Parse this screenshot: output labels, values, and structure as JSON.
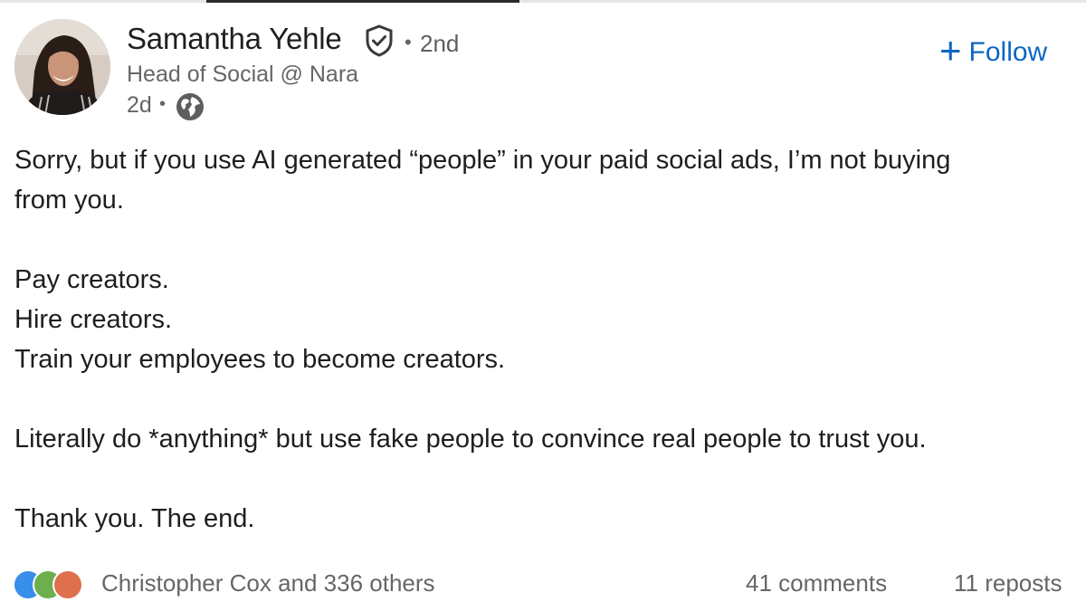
{
  "post": {
    "author": {
      "name": "Samantha Yehle",
      "connection_degree": "2nd",
      "headline": "Head of Social @ Nara",
      "time_posted": "2d",
      "verified_icon": "verified-shield-icon",
      "visibility_icon": "globe-icon"
    },
    "follow_button": {
      "plus": "+",
      "label": "Follow",
      "color": "#0a66c2"
    },
    "separator": "•",
    "body": {
      "line1": "Sorry, but if you use AI generated “people” in your paid social ads, I’m not buying",
      "line2": "from you.",
      "line3": "Pay creators.",
      "line4": "Hire creators.",
      "line5": "Train your employees to become creators.",
      "line6": "Literally do *anything* but use fake people to convince real people to trust you.",
      "line7": "Thank you. The end."
    },
    "social": {
      "reactions_text": "Christopher Cox and 336 others",
      "comments": "41 comments",
      "reposts": "11 reposts",
      "reaction_icons": [
        "like-icon",
        "support-icon",
        "love-icon"
      ]
    }
  }
}
